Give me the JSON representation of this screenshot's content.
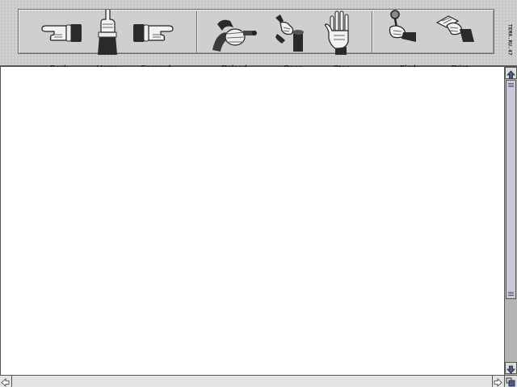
{
  "toolbar": {
    "buttons": [
      {
        "label": "Back",
        "icon": "pointing-hand-left-icon"
      },
      {
        "label": "Home",
        "icon": "pointing-hand-up-icon"
      },
      {
        "label": "Forward",
        "icon": "pointing-hand-right-icon"
      },
      {
        "label": "Reload",
        "icon": "hand-cranking-icon"
      },
      {
        "label": "Open",
        "icon": "hand-opening-jar-icon"
      },
      {
        "label": "Stop",
        "icon": "open-palm-stop-icon"
      },
      {
        "label": "Find",
        "icon": "hand-magnifier-icon"
      },
      {
        "label": "Print",
        "icon": "hand-holding-paper-icon"
      }
    ],
    "logo_text": "TEMA.RU.47"
  },
  "colors": {
    "toolbar_bg": "#cfcfcf",
    "content_bg": "#ffffff",
    "scroll_thumb": "#c9c9d8",
    "scroll_arrow": "#4a5a9a"
  }
}
